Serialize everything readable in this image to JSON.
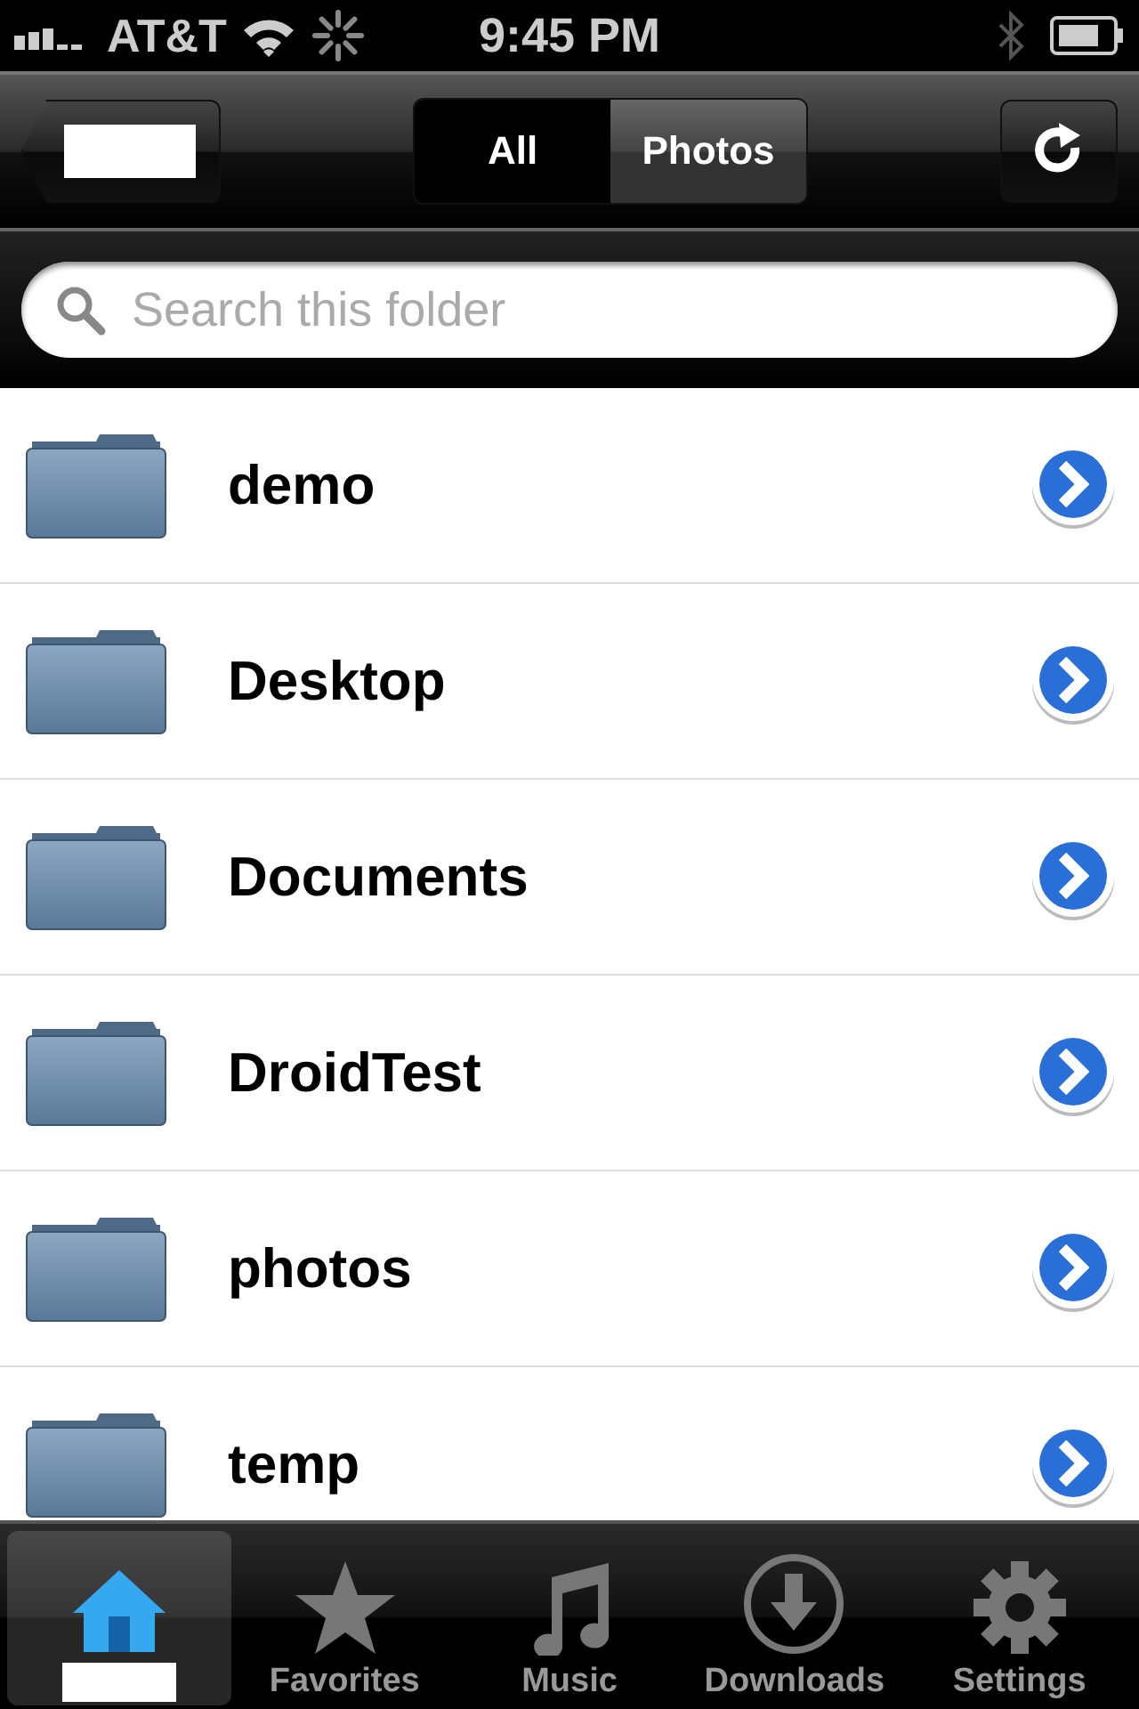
{
  "status_bar": {
    "carrier": "AT&T",
    "time": "9:45 PM"
  },
  "nav_bar": {
    "segments": [
      {
        "label": "All",
        "selected": true
      },
      {
        "label": "Photos",
        "selected": false
      }
    ]
  },
  "search": {
    "placeholder": "Search this folder"
  },
  "folders": [
    {
      "name": "demo"
    },
    {
      "name": "Desktop"
    },
    {
      "name": "Documents"
    },
    {
      "name": "DroidTest"
    },
    {
      "name": "photos"
    },
    {
      "name": "temp"
    }
  ],
  "tab_bar": [
    {
      "kind": "home",
      "selected": true
    },
    {
      "kind": "favorites",
      "label": "Favorites",
      "selected": false
    },
    {
      "kind": "music",
      "label": "Music",
      "selected": false
    },
    {
      "kind": "downloads",
      "label": "Downloads",
      "selected": false
    },
    {
      "kind": "settings",
      "label": "Settings",
      "selected": false
    }
  ]
}
